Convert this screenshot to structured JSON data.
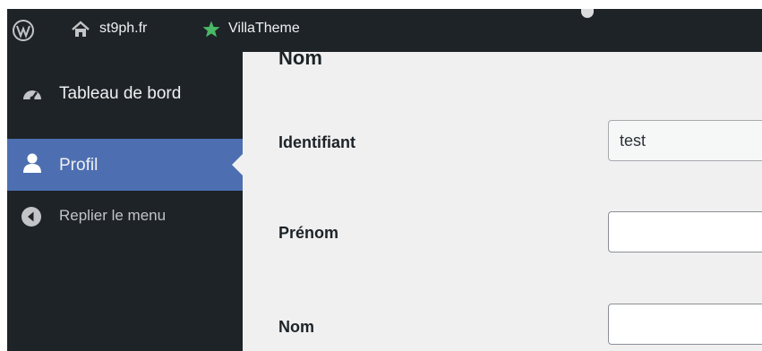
{
  "adminbar": {
    "site_name": "st9ph.fr",
    "villa_label": "VillaTheme"
  },
  "sidebar": {
    "items": [
      {
        "label": "Tableau de bord",
        "icon": "dashboard-icon"
      },
      {
        "label": "Profil",
        "icon": "user-icon",
        "active": true
      },
      {
        "label": "Replier le menu",
        "icon": "collapse-icon"
      }
    ]
  },
  "main": {
    "section_heading": "Nom",
    "fields": {
      "identifiant": {
        "label": "Identifiant",
        "value": "test"
      },
      "prenom": {
        "label": "Prénom",
        "value": ""
      },
      "nom": {
        "label": "Nom",
        "value": ""
      }
    }
  },
  "colors": {
    "adminbar_bg": "#1d2327",
    "sidebar_bg": "#1d2327",
    "active_item_bg": "#4d6fb1",
    "content_bg": "#f0f0f1",
    "star_green": "#4ab866"
  }
}
